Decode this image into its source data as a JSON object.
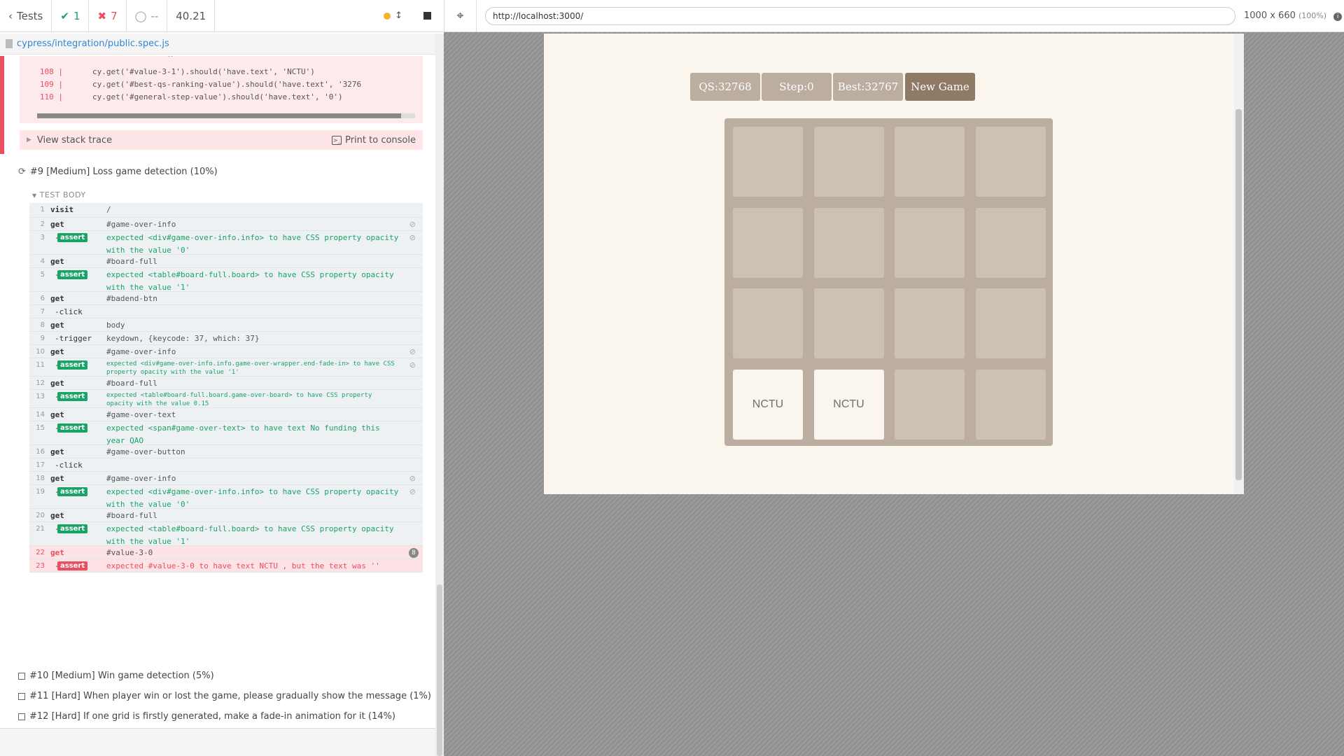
{
  "reporter": {
    "header": {
      "back_label": "Tests",
      "passed": "1",
      "failed": "7",
      "pending": "--",
      "duration": "40.21"
    },
    "spec_file": "cypress/integration/public.spec.js",
    "code_frame": [
      {
        "ln": "",
        "code": "^"
      },
      {
        "ln": "108 |",
        "code": "cy.get('#value-3-1').should('have.text', 'NCTU')"
      },
      {
        "ln": "109 |",
        "code": "cy.get('#best-qs-ranking-value').should('have.text', '3276"
      },
      {
        "ln": "110 |",
        "code": "cy.get('#general-step-value').should('have.text', '0')"
      }
    ],
    "stack_trace_label": "View stack trace",
    "print_console_label": "Print to console",
    "test9_title": "#9 [Medium] Loss game detection (10%)",
    "test_body_label": "TEST BODY",
    "commands": [
      {
        "n": "1",
        "name": "visit",
        "msg": "/"
      },
      {
        "n": "2",
        "name": "get",
        "msg": "#game-over-info"
      },
      {
        "n": "3",
        "name": "-assert",
        "msg": "expected <div#game-over-info.info> to have CSS property opacity with the value '0'"
      },
      {
        "n": "4",
        "name": "get",
        "msg": "#board-full"
      },
      {
        "n": "5",
        "name": "-assert",
        "msg": "expected <table#board-full.board> to have CSS property opacity with the value '1'"
      },
      {
        "n": "6",
        "name": "get",
        "msg": "#badend-btn"
      },
      {
        "n": "7",
        "name": "-click",
        "msg": ""
      },
      {
        "n": "8",
        "name": "get",
        "msg": "body"
      },
      {
        "n": "9",
        "name": "-trigger",
        "msg": "keydown, {keycode: 37, which: 37}"
      },
      {
        "n": "10",
        "name": "get",
        "msg": "#game-over-info"
      },
      {
        "n": "11",
        "name": "-assert",
        "msg": "expected <div#game-over-info.info.game-over-wrapper.end-fade-in> to have CSS property opacity with the value '1'"
      },
      {
        "n": "12",
        "name": "get",
        "msg": "#board-full"
      },
      {
        "n": "13",
        "name": "-assert",
        "msg": "expected <table#board-full.board.game-over-board> to have CSS property opacity with the value 0.15"
      },
      {
        "n": "14",
        "name": "get",
        "msg": "#game-over-text"
      },
      {
        "n": "15",
        "name": "-assert",
        "msg": "expected <span#game-over-text> to have text No funding this year QAO"
      },
      {
        "n": "16",
        "name": "get",
        "msg": "#game-over-button"
      },
      {
        "n": "17",
        "name": "-click",
        "msg": ""
      },
      {
        "n": "18",
        "name": "get",
        "msg": "#game-over-info"
      },
      {
        "n": "19",
        "name": "-assert",
        "msg": "expected <div#game-over-info.info> to have CSS property opacity with the value '0'"
      },
      {
        "n": "20",
        "name": "get",
        "msg": "#board-full"
      },
      {
        "n": "21",
        "name": "-assert",
        "msg": "expected <table#board-full.board> to have CSS property opacity with the value '1'"
      },
      {
        "n": "22",
        "name": "get",
        "msg": "#value-3-0"
      },
      {
        "n": "23",
        "name": "-assert",
        "msg": "expected #value-3-0 to have text NCTU , but the text was ''"
      }
    ],
    "test10_title": "#10 [Medium] Win game detection (5%)",
    "test11_title": "#11 [Hard] When player win or lost the game, please gradually show the message (1%)",
    "test12_title": "#12 [Hard] If one grid is firstly generated, make a fade-in animation for it (14%)"
  },
  "aut": {
    "url": "http://localhost:3000/",
    "viewport": "1000 x 660",
    "viewport_pct": "(100%)",
    "game": {
      "qs": "QS:32768",
      "step": "Step:0",
      "best": "Best:32767",
      "new_game": "New Game",
      "cells": [
        "",
        "",
        "",
        "",
        "",
        "",
        "",
        "",
        "",
        "",
        "",
        "",
        "NCTU",
        "NCTU",
        "",
        ""
      ]
    }
  },
  "colors": {
    "pass": "#1aa366",
    "fail": "#e94f5f",
    "tile_bg": "#cdc1b4",
    "board_bg": "#bbada0",
    "page_bg": "#faf6ed"
  },
  "icons": [
    "chevron-left-icon",
    "check-icon",
    "x-icon",
    "circle-icon",
    "stop-icon",
    "crosshair-icon",
    "info-icon",
    "eye-slash-icon",
    "file-icon",
    "retry-icon",
    "checkbox-icon",
    "console-icon"
  ]
}
